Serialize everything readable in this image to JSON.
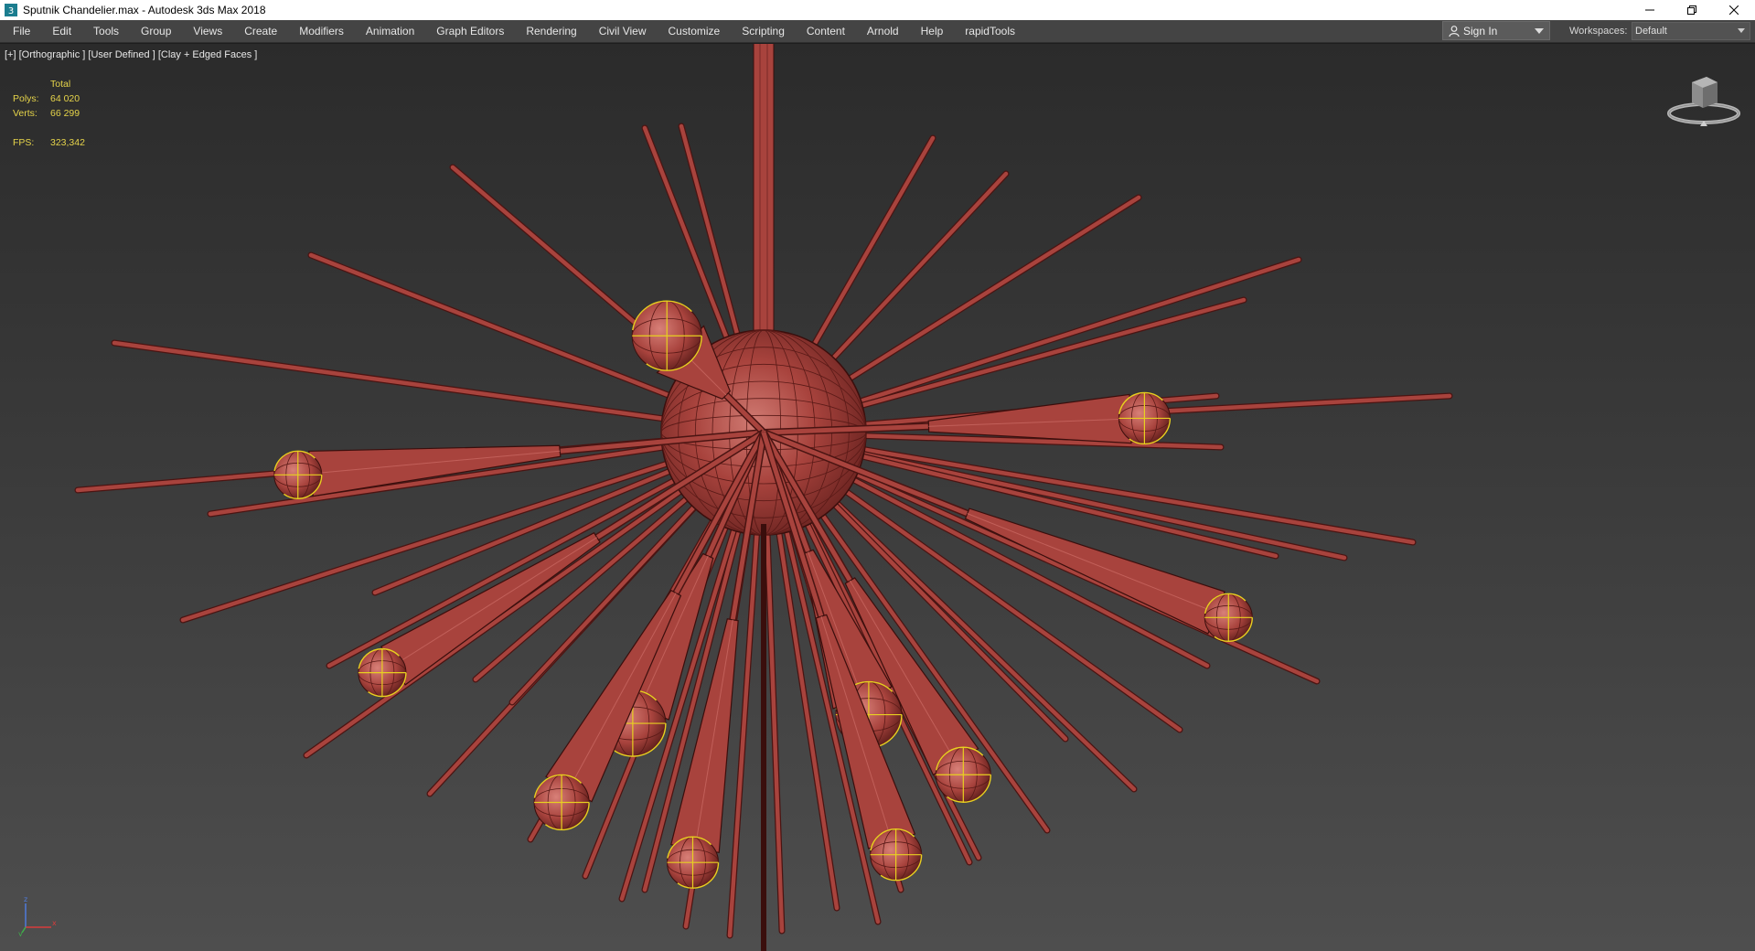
{
  "window": {
    "title": "Sputnik Chandelier.max - Autodesk 3ds Max 2018",
    "controls": [
      "minimize",
      "restore",
      "close"
    ]
  },
  "menubar": {
    "items": [
      "File",
      "Edit",
      "Tools",
      "Group",
      "Views",
      "Create",
      "Modifiers",
      "Animation",
      "Graph Editors",
      "Rendering",
      "Civil View",
      "Customize",
      "Scripting",
      "Content",
      "Arnold",
      "Help",
      "rapidTools"
    ],
    "signin_label": "Sign In",
    "workspaces_label": "Workspaces:",
    "workspace_value": "Default"
  },
  "viewport": {
    "label": "[+] [Orthographic ] [User Defined ] [Clay + Edged Faces ]",
    "stats": {
      "total_header": "Total",
      "polys_label": "Polys:",
      "polys_value": "64 020",
      "verts_label": "Verts:",
      "verts_value": "66 299",
      "fps_label": "FPS:",
      "fps_value": "323,342"
    },
    "axis": {
      "x": "x",
      "y": "y",
      "z": "z"
    },
    "model_color": "#a8433d",
    "selection_color": "#e8d020"
  }
}
